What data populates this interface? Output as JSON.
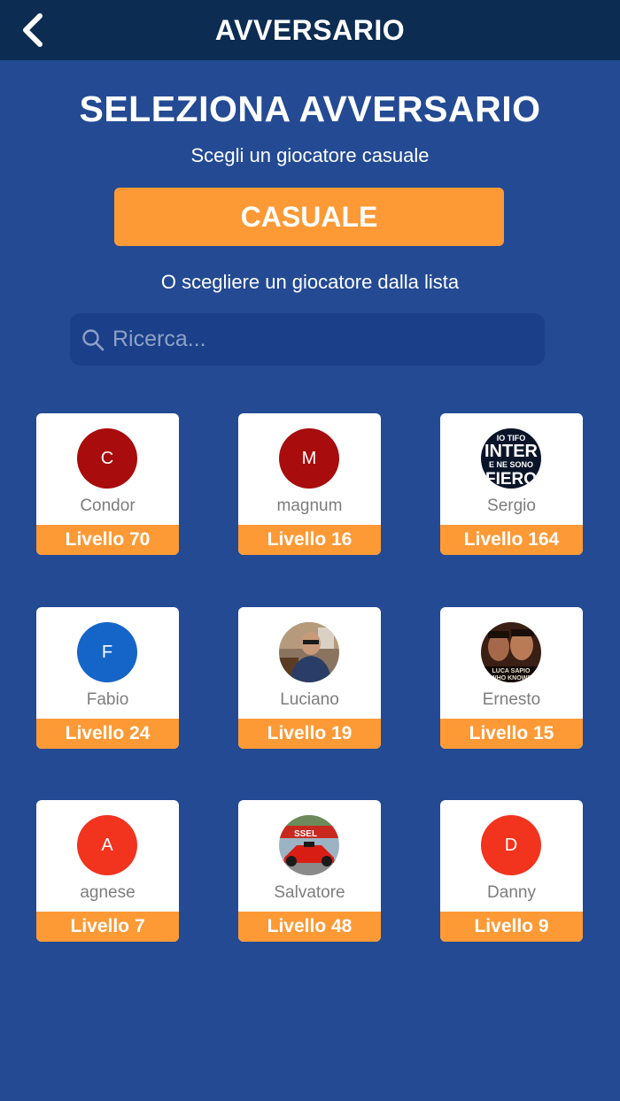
{
  "header": {
    "title": "AVVERSARIO"
  },
  "main": {
    "heading": "SELEZIONA AVVERSARIO",
    "subtitle": "Scegli un giocatore casuale",
    "random_button": "CASUALE",
    "list_prompt": "O scegliere un giocatore dalla lista",
    "search_placeholder": "Ricerca..."
  },
  "colors": {
    "background": "#234a93",
    "topbar": "#0c2c52",
    "accent_orange": "#fd9a36",
    "search_bg": "#1b3f88"
  },
  "players": [
    {
      "name": "Condor",
      "level": "Livello 70",
      "initial": "C",
      "avatar_color": "#a80c0c",
      "avatar_type": "initial"
    },
    {
      "name": "magnum",
      "level": "Livello 16",
      "initial": "M",
      "avatar_color": "#a80c0c",
      "avatar_type": "initial"
    },
    {
      "name": "Sergio",
      "level": "Livello 164",
      "avatar_type": "photo",
      "photo": "inter-badge",
      "photo_text": [
        "IO TIFO",
        "INTER",
        "E NE SONO",
        "FIERO"
      ]
    },
    {
      "name": "Fabio",
      "level": "Livello 24",
      "initial": "F",
      "avatar_color": "#1565c8",
      "avatar_type": "initial"
    },
    {
      "name": "Luciano",
      "level": "Livello 19",
      "avatar_type": "photo",
      "photo": "man-portrait"
    },
    {
      "name": "Ernesto",
      "level": "Livello 15",
      "avatar_type": "photo",
      "photo": "movie-poster",
      "photo_text": [
        "LUCA SAPIO",
        "WHO KNOWS"
      ]
    },
    {
      "name": "agnese",
      "level": "Livello 7",
      "initial": "A",
      "avatar_color": "#f2331e",
      "avatar_type": "initial"
    },
    {
      "name": "Salvatore",
      "level": "Livello 48",
      "avatar_type": "photo",
      "photo": "red-racecar",
      "photo_text": [
        "SSEL"
      ]
    },
    {
      "name": "Danny",
      "level": "Livello 9",
      "initial": "D",
      "avatar_color": "#f2331e",
      "avatar_type": "initial"
    }
  ]
}
